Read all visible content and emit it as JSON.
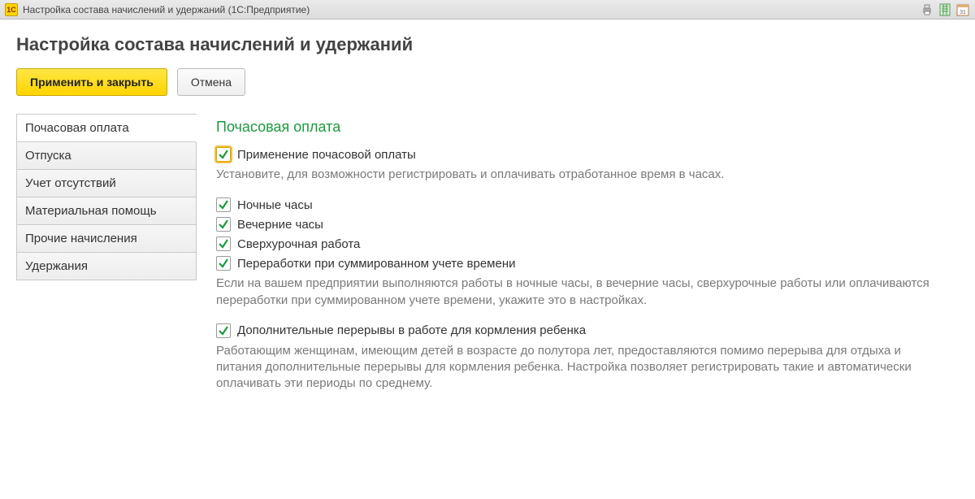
{
  "titlebar": {
    "logo_text": "1C",
    "title": "Настройка состава начислений и удержаний  (1С:Предприятие)"
  },
  "page": {
    "heading": "Настройка состава начислений и удержаний"
  },
  "toolbar": {
    "apply_close": "Применить и закрыть",
    "cancel": "Отмена"
  },
  "sidebar": {
    "items": [
      "Почасовая оплата",
      "Отпуска",
      "Учет отсутствий",
      "Материальная помощь",
      "Прочие начисления",
      "Удержания"
    ],
    "active_index": 0
  },
  "main": {
    "section_title": "Почасовая оплата",
    "check1": {
      "label": "Применение почасовой оплаты",
      "checked": true,
      "hint": "Установите, для возможности регистрировать и оплачивать отработанное время в часах."
    },
    "check2": {
      "label": "Ночные часы",
      "checked": true
    },
    "check3": {
      "label": "Вечерние часы",
      "checked": true
    },
    "check4": {
      "label": "Сверхурочная работа",
      "checked": true
    },
    "check5": {
      "label": "Переработки при суммированном учете времени",
      "checked": true,
      "hint": "Если на вашем предприятии выполняются работы в ночные часы, в вечерние часы, сверхурочные работы или оплачиваются переработки при суммированном учете времени, укажите это в настройках."
    },
    "check6": {
      "label": "Дополнительные перерывы в работе для кормления ребенка",
      "checked": true,
      "hint": "Работающим женщинам, имеющим детей в возрасте до полутора лет, предоставляются помимо перерыва для отдыха и питания дополнительные перерывы для кормления ребенка. Настройка позволяет регистрировать такие и автоматически оплачивать эти периоды по среднему."
    }
  }
}
